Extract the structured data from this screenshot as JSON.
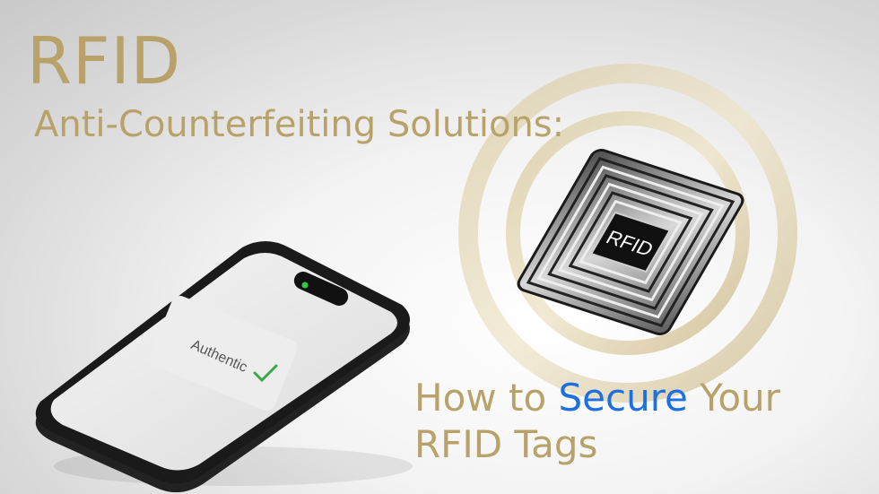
{
  "colors": {
    "gold": "#b8a26a",
    "highlight_blue": "#1e6fe0",
    "check_green": "#3aa84a",
    "led_green": "#2ecc40"
  },
  "banner": {
    "title": "RFID",
    "subtitle": "Anti-Counterfeiting Solutions:",
    "tagline": {
      "before": "How to ",
      "highlight": "Secure",
      "after": " Your",
      "line2": "RFID Tags"
    }
  },
  "device": {
    "screen_text": "Authentic",
    "status_icon": "checkmark-icon"
  },
  "tag": {
    "chip_label": "RFID"
  }
}
